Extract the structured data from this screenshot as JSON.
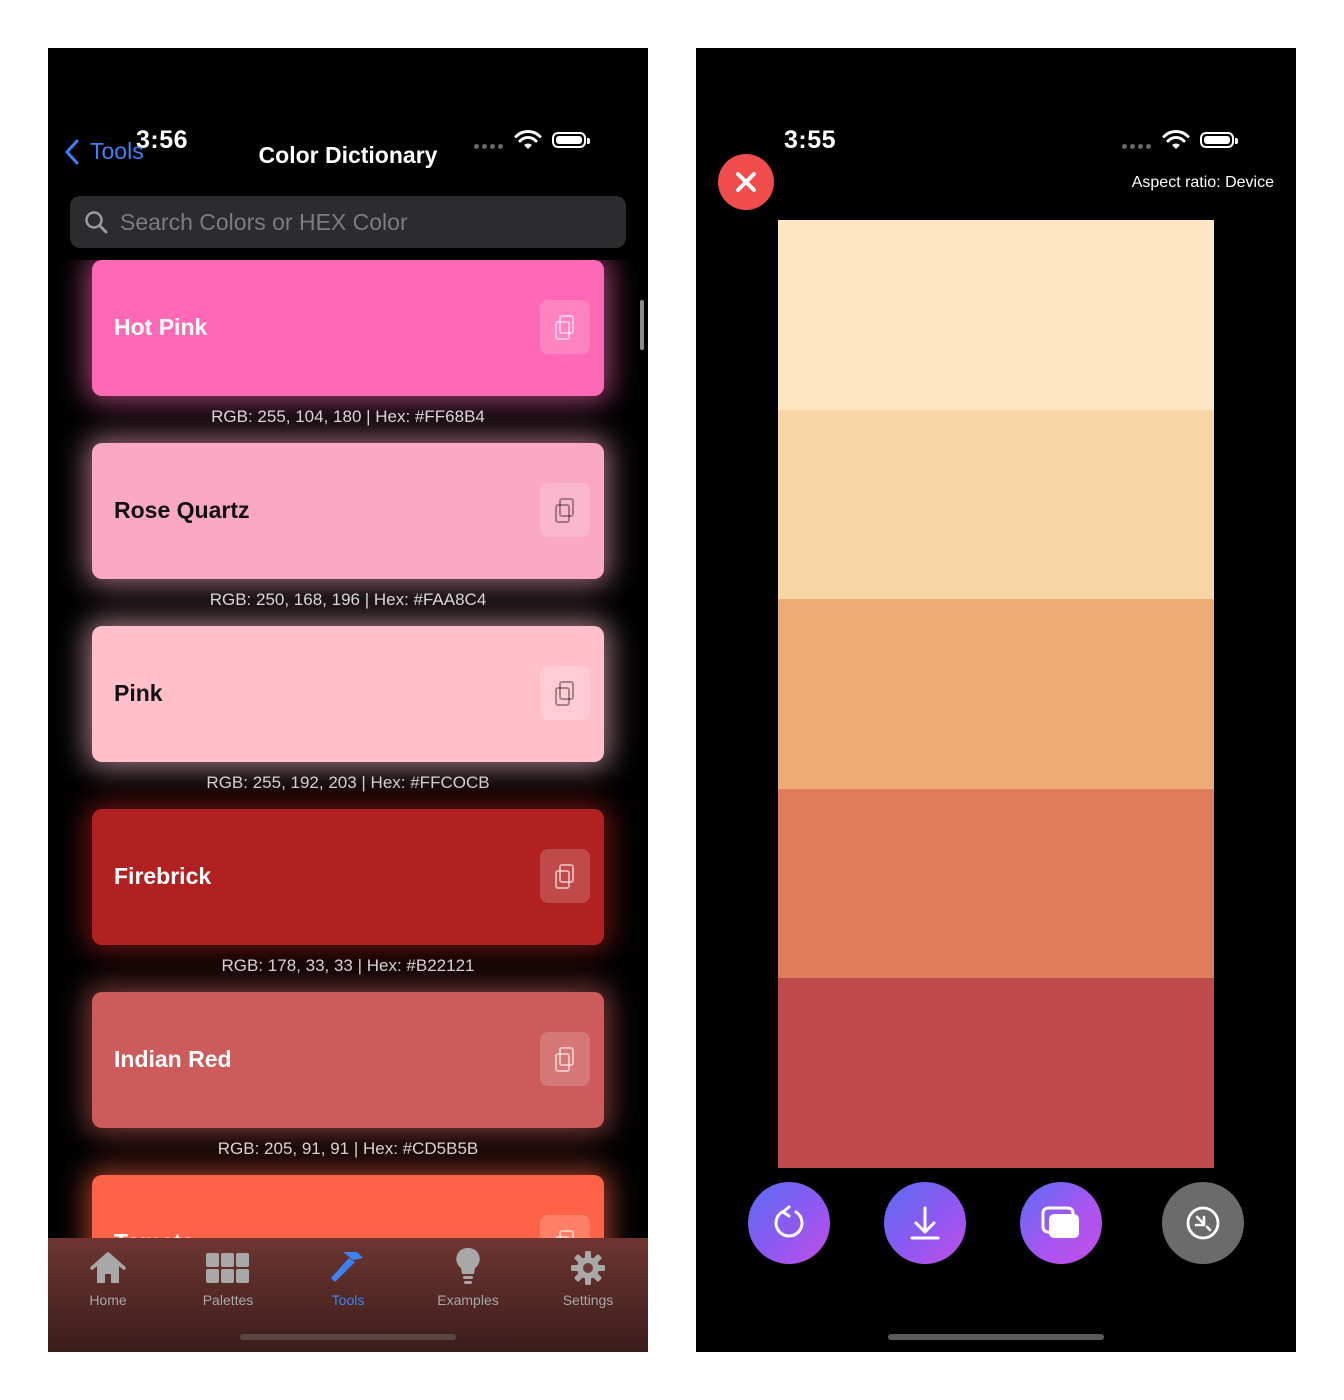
{
  "left": {
    "status_time": "3:56",
    "nav": {
      "back_label": "Tools",
      "title": "Color Dictionary"
    },
    "search": {
      "placeholder": "Search Colors or HEX Color"
    },
    "colors": [
      {
        "name": "Hot Pink",
        "info": "RGB: 255, 104, 180 | Hex: #FF68B4",
        "hex": "#FF68B4",
        "text_color": "#ffffff"
      },
      {
        "name": "Rose Quartz",
        "info": "RGB: 250, 168, 196 | Hex: #FAA8C4",
        "hex": "#FAA8C4",
        "text_color": "#111111"
      },
      {
        "name": "Pink",
        "info": "RGB: 255, 192, 203 | Hex: #FFCOCB",
        "hex": "#FFC0CB",
        "text_color": "#111111"
      },
      {
        "name": "Firebrick",
        "info": "RGB: 178, 33, 33 | Hex: #B22121",
        "hex": "#B22121",
        "text_color": "#ffffff"
      },
      {
        "name": "Indian Red",
        "info": "RGB: 205, 91, 91 | Hex: #CD5B5B",
        "hex": "#CD5B5B",
        "text_color": "#ffffff"
      },
      {
        "name": "Tomato",
        "info": "",
        "hex": "#FF6347",
        "text_color": "#ffffff"
      }
    ],
    "tabs": [
      {
        "label": "Home",
        "icon": "house-icon",
        "active": false
      },
      {
        "label": "Palettes",
        "icon": "grid-icon",
        "active": false
      },
      {
        "label": "Tools",
        "icon": "hammer-icon",
        "active": true
      },
      {
        "label": "Examples",
        "icon": "lightbulb-icon",
        "active": false
      },
      {
        "label": "Settings",
        "icon": "gear-icon",
        "active": false
      }
    ],
    "accent": "#3A82F7"
  },
  "right": {
    "status_time": "3:55",
    "aspect_label": "Aspect ratio: Device",
    "palette": [
      "#FFE6C3",
      "#F8D5A5",
      "#EDAC72",
      "#DE7C5B",
      "#BE4A4B"
    ],
    "buttons": [
      {
        "name": "refresh-button",
        "icon": "refresh-icon",
        "color": "#8E58F0"
      },
      {
        "name": "download-button",
        "icon": "download-icon",
        "color": "#8E58F0"
      },
      {
        "name": "copy-button",
        "icon": "copy-icon",
        "color": "#A855F0"
      },
      {
        "name": "collapse-button",
        "icon": "collapse-icon",
        "color": "#6B6B6B"
      }
    ]
  }
}
